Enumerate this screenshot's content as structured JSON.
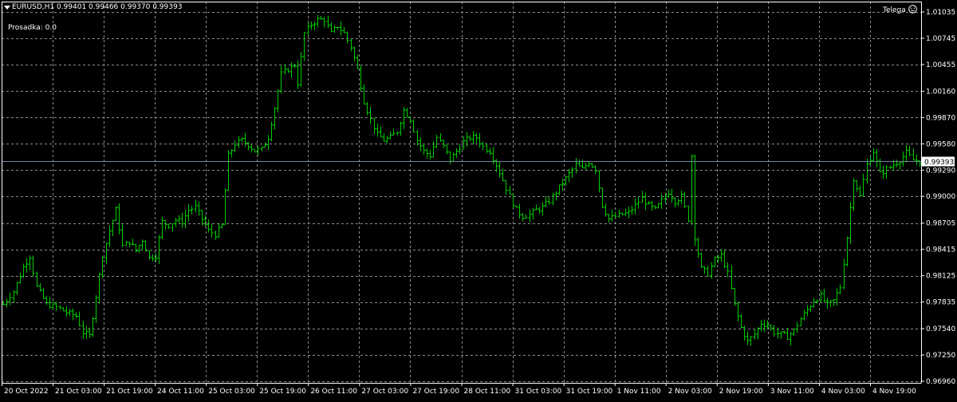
{
  "header": {
    "dropdown_arrow_icon": "triangle-down-icon",
    "symbol_info": "EURUSD,H1  0.99401 0.99466 0.99370 0.99393",
    "drawdown_label": "Prosadka: 0.0",
    "indicator_name": "Telega",
    "indicator_icon": "smiley-icon"
  },
  "colors": {
    "background": "#000000",
    "candle": "#00cc00",
    "grid": "#8c8c8c",
    "axis": "#ffffff",
    "bid_line": "#6f83a0",
    "price_tag_bg": "#ffffff",
    "price_tag_text": "#000000"
  },
  "chart_data": {
    "type": "ohlc",
    "symbol": "EURUSD",
    "timeframe": "H1",
    "current_price": "0.99393",
    "y_axis": {
      "ticks": [
        "1.01035",
        "1.00745",
        "1.00455",
        "1.00160",
        "0.99870",
        "0.99580",
        "0.99290",
        "0.99000",
        "0.98705",
        "0.98415",
        "0.98125",
        "0.97835",
        "0.97540",
        "0.97250",
        "0.96960"
      ],
      "range": [
        0.9696,
        1.01035
      ]
    },
    "x_axis": {
      "ticks": [
        "20 Oct 2022",
        "21 Oct 03:00",
        "21 Oct 19:00",
        "24 Oct 11:00",
        "25 Oct 03:00",
        "25 Oct 19:00",
        "26 Oct 11:00",
        "27 Oct 03:00",
        "27 Oct 19:00",
        "28 Oct 11:00",
        "31 Oct 03:00",
        "31 Oct 19:00",
        "1 Nov 11:00",
        "2 Nov 03:00",
        "2 Nov 19:00",
        "3 Nov 11:00",
        "4 Nov 03:00",
        "4 Nov 19:00"
      ]
    },
    "grid": true,
    "close_path": [
      [
        0,
        0.9781
      ],
      [
        3,
        0.9795
      ],
      [
        6,
        0.9822
      ],
      [
        8,
        0.9834
      ],
      [
        10,
        0.98
      ],
      [
        13,
        0.9781
      ],
      [
        16,
        0.9778
      ],
      [
        19,
        0.9772
      ],
      [
        22,
        0.9768
      ],
      [
        24,
        0.975
      ],
      [
        26,
        0.9746
      ],
      [
        28,
        0.979
      ],
      [
        30,
        0.9835
      ],
      [
        32,
        0.9862
      ],
      [
        34,
        0.9885
      ],
      [
        36,
        0.9845
      ],
      [
        38,
        0.985
      ],
      [
        40,
        0.984
      ],
      [
        42,
        0.9852
      ],
      [
        44,
        0.9832
      ],
      [
        46,
        0.9835
      ],
      [
        48,
        0.9872
      ],
      [
        50,
        0.9868
      ],
      [
        52,
        0.9874
      ],
      [
        54,
        0.9872
      ],
      [
        56,
        0.9885
      ],
      [
        58,
        0.9888
      ],
      [
        60,
        0.9875
      ],
      [
        62,
        0.9862
      ],
      [
        64,
        0.9858
      ],
      [
        66,
        0.9868
      ],
      [
        68,
        0.9945
      ],
      [
        70,
        0.9958
      ],
      [
        72,
        0.9962
      ],
      [
        74,
        0.9957
      ],
      [
        76,
        0.995
      ],
      [
        78,
        0.9952
      ],
      [
        80,
        0.9965
      ],
      [
        82,
        0.9998
      ],
      [
        84,
        1.0035
      ],
      [
        86,
        1.004
      ],
      [
        88,
        1.0045
      ],
      [
        89,
        1.0025
      ],
      [
        91,
        1.008
      ],
      [
        93,
        1.009
      ],
      [
        95,
        1.0095
      ],
      [
        97,
        1.0095
      ],
      [
        99,
        1.008
      ],
      [
        101,
        1.0088
      ],
      [
        103,
        1.008
      ],
      [
        105,
        1.0065
      ],
      [
        107,
        1.004
      ],
      [
        109,
        1.0005
      ],
      [
        111,
        0.9985
      ],
      [
        113,
        0.9968
      ],
      [
        115,
        0.9962
      ],
      [
        117,
        0.9965
      ],
      [
        119,
        0.9972
      ],
      [
        121,
        0.9995
      ],
      [
        123,
        0.9985
      ],
      [
        125,
        0.9962
      ],
      [
        127,
        0.995
      ],
      [
        129,
        0.9945
      ],
      [
        131,
        0.9965
      ],
      [
        133,
        0.9955
      ],
      [
        135,
        0.994
      ],
      [
        137,
        0.995
      ],
      [
        139,
        0.996
      ],
      [
        141,
        0.9965
      ],
      [
        143,
        0.9965
      ],
      [
        145,
        0.9955
      ],
      [
        147,
        0.995
      ],
      [
        149,
        0.9935
      ],
      [
        151,
        0.9918
      ],
      [
        153,
        0.99
      ],
      [
        155,
        0.9885
      ],
      [
        157,
        0.9878
      ],
      [
        159,
        0.988
      ],
      [
        161,
        0.9885
      ],
      [
        163,
        0.9888
      ],
      [
        165,
        0.9895
      ],
      [
        167,
        0.9905
      ],
      [
        169,
        0.9915
      ],
      [
        171,
        0.9925
      ],
      [
        173,
        0.9935
      ],
      [
        175,
        0.993
      ],
      [
        177,
        0.9938
      ],
      [
        179,
        0.993
      ],
      [
        181,
        0.989
      ],
      [
        183,
        0.9875
      ],
      [
        185,
        0.9878
      ],
      [
        187,
        0.988
      ],
      [
        189,
        0.9882
      ],
      [
        191,
        0.989
      ],
      [
        193,
        0.9898
      ],
      [
        195,
        0.989
      ],
      [
        197,
        0.9885
      ],
      [
        199,
        0.9895
      ],
      [
        201,
        0.9905
      ],
      [
        203,
        0.9895
      ],
      [
        205,
        0.99
      ],
      [
        207,
        0.9875
      ],
      [
        208,
        0.9945
      ],
      [
        209,
        0.9855
      ],
      [
        211,
        0.982
      ],
      [
        213,
        0.9815
      ],
      [
        215,
        0.983
      ],
      [
        217,
        0.9835
      ],
      [
        219,
        0.9815
      ],
      [
        221,
        0.978
      ],
      [
        223,
        0.9755
      ],
      [
        225,
        0.974
      ],
      [
        227,
        0.9748
      ],
      [
        229,
        0.976
      ],
      [
        231,
        0.9758
      ],
      [
        233,
        0.975
      ],
      [
        235,
        0.9748
      ],
      [
        237,
        0.9745
      ],
      [
        239,
        0.9752
      ],
      [
        241,
        0.9765
      ],
      [
        243,
        0.9775
      ],
      [
        245,
        0.9785
      ],
      [
        247,
        0.979
      ],
      [
        249,
        0.978
      ],
      [
        251,
        0.9785
      ],
      [
        253,
        0.98
      ],
      [
        255,
        0.9855
      ],
      [
        257,
        0.992
      ],
      [
        259,
        0.99
      ],
      [
        261,
        0.9935
      ],
      [
        263,
        0.995
      ],
      [
        265,
        0.9925
      ],
      [
        267,
        0.993
      ],
      [
        269,
        0.9935
      ],
      [
        271,
        0.994
      ],
      [
        273,
        0.9948
      ],
      [
        275,
        0.994
      ],
      [
        277,
        0.9939
      ]
    ]
  }
}
